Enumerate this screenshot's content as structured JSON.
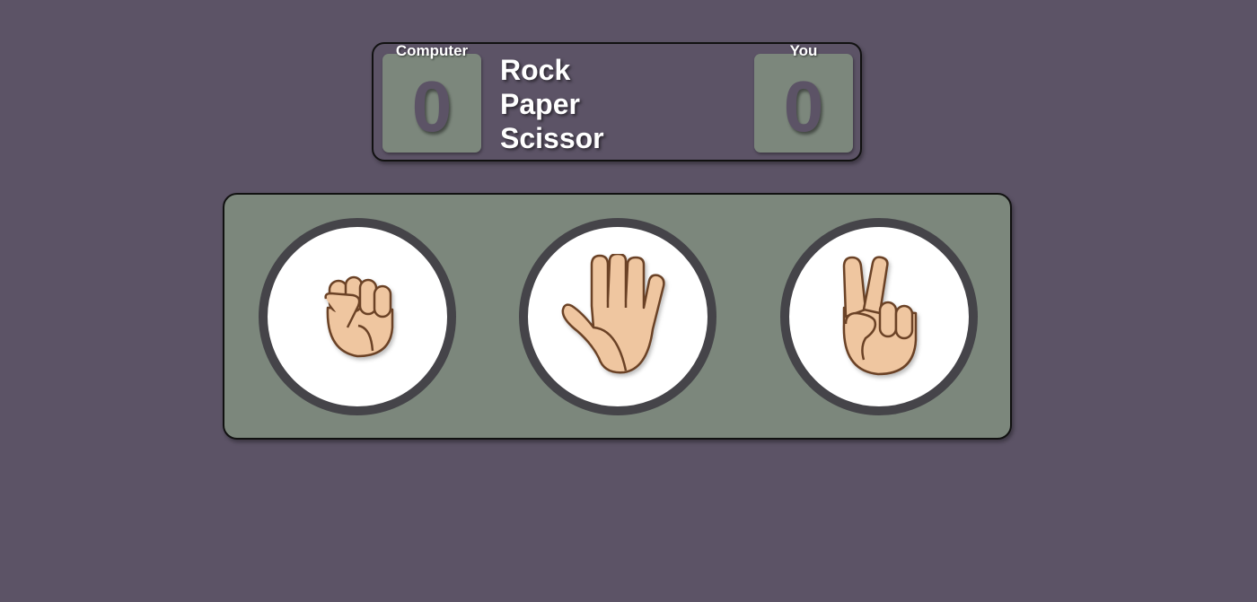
{
  "scoreboard": {
    "computer_label": "Computer",
    "computer_score": "0",
    "you_label": "You",
    "you_score": "0",
    "title_lines": [
      "Rock",
      "Paper",
      "Scissor"
    ]
  },
  "choices": [
    {
      "id": "rock",
      "icon": "raised-fist-icon"
    },
    {
      "id": "paper",
      "icon": "raised-hand-icon"
    },
    {
      "id": "scissor",
      "icon": "victory-hand-icon"
    }
  ],
  "colors": {
    "background": "#5c5366",
    "panel": "#7c877c",
    "ring": "#454449",
    "skin": "#efc6a0",
    "skin_outline": "#6b4226"
  }
}
